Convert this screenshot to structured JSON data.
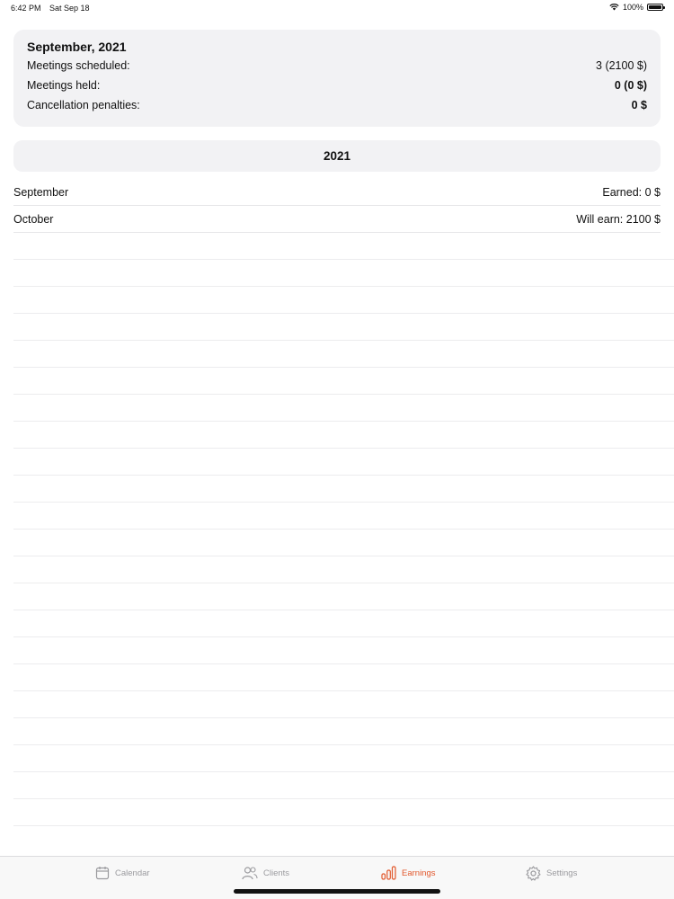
{
  "status_bar": {
    "time": "6:42 PM",
    "date": "Sat Sep 18",
    "battery": "100%"
  },
  "summary": {
    "title": "September, 2021",
    "rows": [
      {
        "label": "Meetings scheduled:",
        "value": "3 (2100 $)"
      },
      {
        "label": "Meetings held:",
        "value": "0 (0 $)"
      },
      {
        "label": "Cancellation penalties:",
        "value": "0 $"
      }
    ]
  },
  "year_header": "2021",
  "months": [
    {
      "name": "September",
      "amount": "Earned: 0 $"
    },
    {
      "name": "October",
      "amount": "Will earn: 2100 $"
    }
  ],
  "tabs": [
    {
      "label": "Calendar",
      "icon": "calendar-icon",
      "active": false
    },
    {
      "label": "Clients",
      "icon": "people-icon",
      "active": false
    },
    {
      "label": "Earnings",
      "icon": "bar-chart-icon",
      "active": true
    },
    {
      "label": "Settings",
      "icon": "gear-icon",
      "active": false
    }
  ],
  "colors": {
    "accent": "#e2582c",
    "inactive_tab": "#9a9a9e",
    "card_background": "#f2f2f4"
  }
}
